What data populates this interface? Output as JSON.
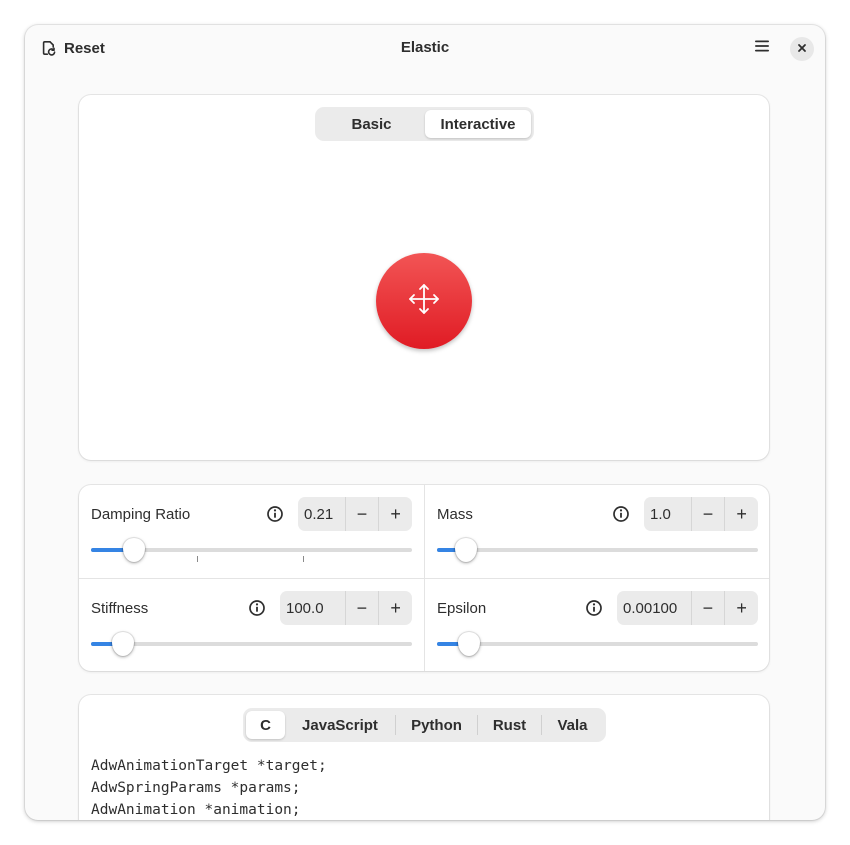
{
  "header": {
    "reset_label": "Reset",
    "title": "Elastic",
    "icons": {
      "reset": "reset-icon",
      "menu": "hamburger-menu-icon",
      "close": "close-icon"
    }
  },
  "demo": {
    "tabs": [
      {
        "label": "Basic",
        "active": false
      },
      {
        "label": "Interactive",
        "active": true
      }
    ],
    "ball_icon": "move-arrows-icon",
    "ball_color": "#e01b24"
  },
  "params": {
    "damping": {
      "label": "Damping Ratio",
      "value": "0.21",
      "slider_fraction": 0.135
    },
    "mass": {
      "label": "Mass",
      "value": "1.0",
      "slider_fraction": 0.09
    },
    "stiffness": {
      "label": "Stiffness",
      "value": "100.0",
      "slider_fraction": 0.1
    },
    "epsilon": {
      "label": "Epsilon",
      "value": "0.00100",
      "slider_fraction": 0.1
    },
    "minus_symbol": "−",
    "plus_symbol": "+"
  },
  "code_section": {
    "tabs": [
      {
        "label": "C",
        "active": true
      },
      {
        "label": "JavaScript",
        "active": false
      },
      {
        "label": "Python",
        "active": false
      },
      {
        "label": "Rust",
        "active": false
      },
      {
        "label": "Vala",
        "active": false
      }
    ],
    "lines": [
      "AdwAnimationTarget *target;",
      "AdwSpringParams *params;",
      "AdwAnimation *animation;"
    ]
  },
  "colors": {
    "accent": "#3584e4",
    "ball": "#e01b24"
  }
}
